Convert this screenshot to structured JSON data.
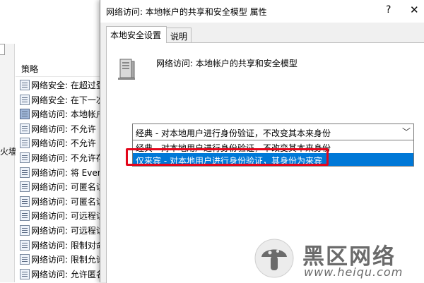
{
  "background": {
    "list_header": "策略",
    "side_label": "火墙",
    "policies": [
      {
        "label": "网络安全: 在超过登",
        "selected": false
      },
      {
        "label": "网络安全: 在下一次",
        "selected": false
      },
      {
        "label": "网络访问: 本地帐户",
        "selected": true
      },
      {
        "label": "网络访问: 不允许",
        "selected": false
      },
      {
        "label": "网络访问: 不允许",
        "selected": false
      },
      {
        "label": "网络访问: 不允许存",
        "selected": false
      },
      {
        "label": "网络访问: 将 Every",
        "selected": false
      },
      {
        "label": "网络访问: 可匿名访",
        "selected": false
      },
      {
        "label": "网络访问: 可匿名访",
        "selected": false
      },
      {
        "label": "网络访问: 可远程访",
        "selected": false
      },
      {
        "label": "网络访问: 可远程访",
        "selected": false
      },
      {
        "label": "网络访问: 限制对命",
        "selected": false
      },
      {
        "label": "网络访问: 限制允许",
        "selected": false
      },
      {
        "label": "网络访问: 允许匿名",
        "selected": false
      }
    ]
  },
  "dialog": {
    "title": "网络访问: 本地帐户的共享和安全模型 属性",
    "help_glyph": "?",
    "close_glyph": "✕",
    "tabs": [
      {
        "label": "本地安全设置",
        "active": true
      },
      {
        "label": "说明",
        "active": false
      }
    ],
    "policy_name": "网络访问: 本地帐户的共享和安全模型",
    "select_value": "经典 - 对本地用户进行身份验证，不改变其本来身份",
    "options": [
      {
        "label": "经典 - 对本地用户进行身份验证，不改变其本来身份",
        "highlighted": false
      },
      {
        "label": "仅来宾 - 对本地用户进行身份验证，其身份为来宾",
        "highlighted": true
      }
    ]
  },
  "watermark": {
    "name": "黑区网络",
    "url": "www.heiqu.com"
  },
  "colors": {
    "highlight": "#0078d7",
    "annotation": "#e3061b",
    "dialog_bg": "#f0f0f0"
  }
}
